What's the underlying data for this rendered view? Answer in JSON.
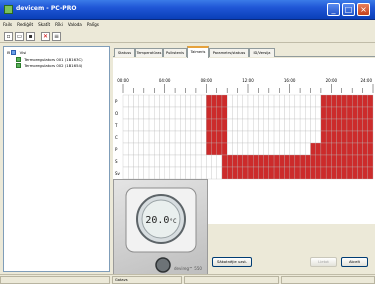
{
  "window": {
    "title": "devicem - PC-PRO",
    "colors": {
      "accent": "#1f56d6",
      "on": "#cc2b2b",
      "off": "#ffffff"
    }
  },
  "menu": [
    "Fails",
    "Rediģēt",
    "Skatīt",
    "Rīki",
    "Valoda",
    "Palīgs"
  ],
  "toolbar": {
    "icons": [
      "new-file-icon",
      "open-folder-icon",
      "save-icon",
      "delete-icon",
      "properties-icon"
    ]
  },
  "tree": {
    "root": "Visi",
    "items": [
      "Termoregulators 001 (1B163C)",
      "Termoregulators 002 (1B1654)"
    ]
  },
  "tabs": [
    "Statuss",
    "Temperatūras",
    "Pulkstenis",
    "Taimeris",
    "Parametrs",
    "Funkcijas/Programmas",
    "ID/Versija"
  ],
  "tabs_display": [
    "Statuss",
    "Temperatūras",
    "Pulkstenis",
    "Taimeris",
    "Parametrs/statuss",
    "ID/Versija"
  ],
  "active_tab": "Taimeris",
  "schedule": {
    "hours": [
      "00:00",
      "04:00",
      "08:00",
      "12:00",
      "16:00",
      "20:00",
      "24:00"
    ],
    "days": [
      "P",
      "O",
      "T",
      "C",
      "P",
      "S",
      "Sv"
    ],
    "cols_per_day": 48,
    "on_ranges": [
      [
        [
          16,
          20
        ],
        [
          38,
          48
        ]
      ],
      [
        [
          16,
          20
        ],
        [
          38,
          48
        ]
      ],
      [
        [
          16,
          20
        ],
        [
          38,
          48
        ]
      ],
      [
        [
          16,
          20
        ],
        [
          38,
          48
        ]
      ],
      [
        [
          16,
          20
        ],
        [
          36,
          48
        ]
      ],
      [
        [
          19,
          48
        ]
      ],
      [
        [
          19,
          48
        ]
      ]
    ]
  },
  "device": {
    "display": "20.0",
    "unit": "°C",
    "brand": "devireg™ 550"
  },
  "buttons": {
    "sync": "Sākotnējie uzst.",
    "apply": "Lietot",
    "cancel": "Atcelt"
  },
  "statusbar": [
    "",
    "Gatavs",
    "",
    ""
  ]
}
